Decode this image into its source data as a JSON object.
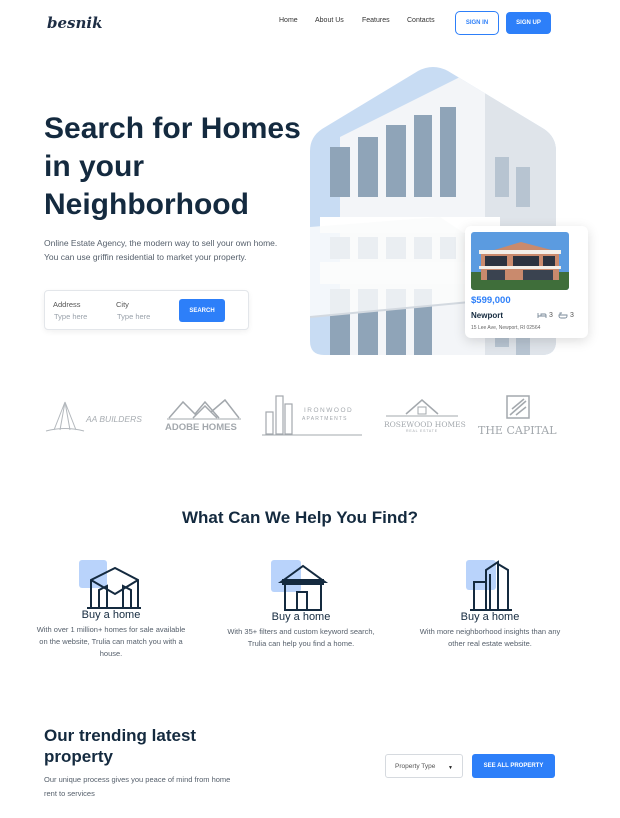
{
  "header": {
    "logo": "besnik",
    "nav": [
      "Home",
      "About Us",
      "Features",
      "Contacts"
    ],
    "sign_in": "SIGN IN",
    "sign_up": "SIGN UP"
  },
  "hero": {
    "title": "Search for Homes in your Neighborhood",
    "description": "Online Estate Agency, the modern way to sell your own home. You can use griffin residential to market your property.",
    "search": {
      "address_label": "Address",
      "address_placeholder": "Type here",
      "city_label": "City",
      "city_placeholder": "Type here",
      "button": "SEARCH"
    },
    "listing_card": {
      "price": "$599,000",
      "name": "Newport",
      "beds": "3",
      "baths": "3",
      "address": "15 Lee Ave, Newport, RI 02564"
    }
  },
  "brands": [
    "AA BUILDERS",
    "ADOBE HOMES",
    "IRONWOOD",
    "APARTMENTS",
    "ROSEWOOD HOMES",
    "REAL ESTATE",
    "THE CAPITAL"
  ],
  "help": {
    "title": "What Can We Help You Find?",
    "features": [
      {
        "title": "Buy a home",
        "description": "With over 1 million+ homes for sale available on the website, Trulia can match you with a house."
      },
      {
        "title": "Buy a home",
        "description": "With 35+ filters and custom keyword search, Trulia can help you find a home."
      },
      {
        "title": "Buy a home",
        "description": "With more neighborhood insights than any other real estate website."
      }
    ]
  },
  "trending": {
    "title": "Our trending latest property",
    "description": "Our unique process gives you peace of mind from home rent to services",
    "property_type": "Property Type",
    "see_all": "SEE ALL PROPERTY"
  },
  "colors": {
    "accent": "#2d7ff9",
    "heading": "#142a3f",
    "icon_bg": "#b9d3fb"
  }
}
